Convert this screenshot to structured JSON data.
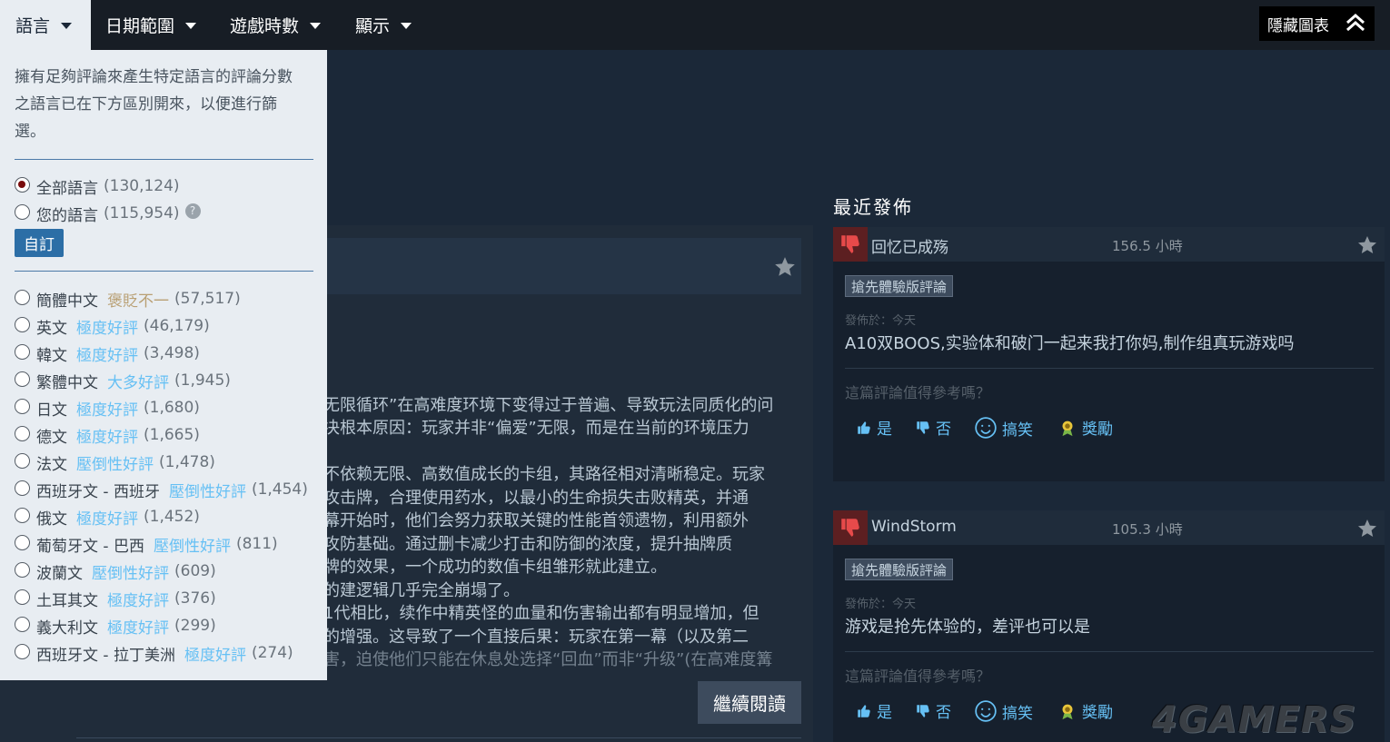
{
  "menu": {
    "tabs": [
      {
        "label": "語言",
        "active": true
      },
      {
        "label": "日期範圍",
        "active": false
      },
      {
        "label": "遊戲時數",
        "active": false
      },
      {
        "label": "顯示",
        "active": false
      }
    ],
    "hide_graph_label": "隱藏圖表"
  },
  "language_filter": {
    "description_lines": [
      "擁有足夠評論來產生特定語言的評論分數",
      "之語言已在下方區別開來，以便進行篩",
      "選。"
    ],
    "options": [
      {
        "name": "全部語言",
        "count": "(130,124)",
        "checked": true
      },
      {
        "name": "您的語言",
        "count": "(115,954)",
        "checked": false,
        "help": "?"
      }
    ],
    "custom_button": "自訂",
    "languages": [
      {
        "name": "簡體中文",
        "score": "褒貶不一",
        "score_color": "#b9a074",
        "count": "(57,517)"
      },
      {
        "name": "英文",
        "score": "極度好評",
        "score_color": "#66c0f4",
        "count": "(46,179)"
      },
      {
        "name": "韓文",
        "score": "極度好評",
        "score_color": "#66c0f4",
        "count": "(3,498)"
      },
      {
        "name": "繁體中文",
        "score": "大多好評",
        "score_color": "#66c0f4",
        "count": "(1,945)"
      },
      {
        "name": "日文",
        "score": "極度好評",
        "score_color": "#66c0f4",
        "count": "(1,680)"
      },
      {
        "name": "德文",
        "score": "極度好評",
        "score_color": "#66c0f4",
        "count": "(1,665)"
      },
      {
        "name": "法文",
        "score": "壓倒性好評",
        "score_color": "#66c0f4",
        "count": "(1,478)"
      },
      {
        "name": "西班牙文 - 西班牙",
        "score": "壓倒性好評",
        "score_color": "#66c0f4",
        "count": "(1,454)"
      },
      {
        "name": "俄文",
        "score": "極度好評",
        "score_color": "#66c0f4",
        "count": "(1,452)"
      },
      {
        "name": "葡萄牙文 - 巴西",
        "score": "壓倒性好評",
        "score_color": "#66c0f4",
        "count": "(811)"
      },
      {
        "name": "波蘭文",
        "score": "壓倒性好評",
        "score_color": "#66c0f4",
        "count": "(609)"
      },
      {
        "name": "土耳其文",
        "score": "極度好評",
        "score_color": "#66c0f4",
        "count": "(376)"
      },
      {
        "name": "義大利文",
        "score": "極度好評",
        "score_color": "#66c0f4",
        "count": "(299)"
      },
      {
        "name": "西班牙文 - 拉丁美洲",
        "score": "極度好評",
        "score_color": "#66c0f4",
        "count": "(274)"
      }
    ]
  },
  "review_excerpt": {
    "lines": [
      "无限循环”在高难度环境下变得过于普遍、导致玩法同质化的问",
      "决根本原因：玩家并非“偏爱”无限，而是在当前的环境压力",
      "不依赖无限、高数值成长的卡组，其路径相对清晰稳定。玩家",
      "攻击牌，合理使用药水，以最小的生命损失击败精英，并通",
      "幕开始时，他们会努力获取关键的性能首领遗物，利用额外",
      "攻防基础。通过删卡减少打击和防御的浓度，提升抽牌质",
      "牌的效果，一个成功的数值卡组雏形就此建立。",
      "的建逻辑几乎完全崩塌了。",
      "1代相比，续作中精英怪的血量和伤害输出都有明显增加，但",
      "的增强。这导致了一个直接后果：玩家在第一幕（以及第二",
      "害，迫使他们只能在休息处选择“回血”而非“升级”(在高难度篝"
    ],
    "read_more": "繼續閱讀"
  },
  "recent": {
    "title": "最近發佈",
    "reviews": [
      {
        "author": "回忆已成殇",
        "hours": "156.5 小時",
        "badge": "搶先體驗版評論",
        "posted": "發佈於：今天",
        "content": "A10双BOOS,实验体和破门一起来我打你妈,制作组真玩游戏吗",
        "helpful_q": "這篇評論值得參考嗎？",
        "yes": "是",
        "no": "否",
        "funny": "搞笑",
        "award": "獎勵"
      },
      {
        "author": "WindStorm",
        "hours": "105.3 小時",
        "badge": "搶先體驗版評論",
        "posted": "發佈於：今天",
        "content": "游戏是抢先体验的，差评也可以是",
        "helpful_q": "這篇評論值得參考嗎？",
        "yes": "是",
        "no": "否",
        "funny": "搞笑",
        "award": "獎勵"
      }
    ]
  },
  "watermark": "4GAMERS",
  "colors": {
    "accent": "#66c0f4",
    "mixed": "#b9a074",
    "bg": "#1b2838"
  }
}
